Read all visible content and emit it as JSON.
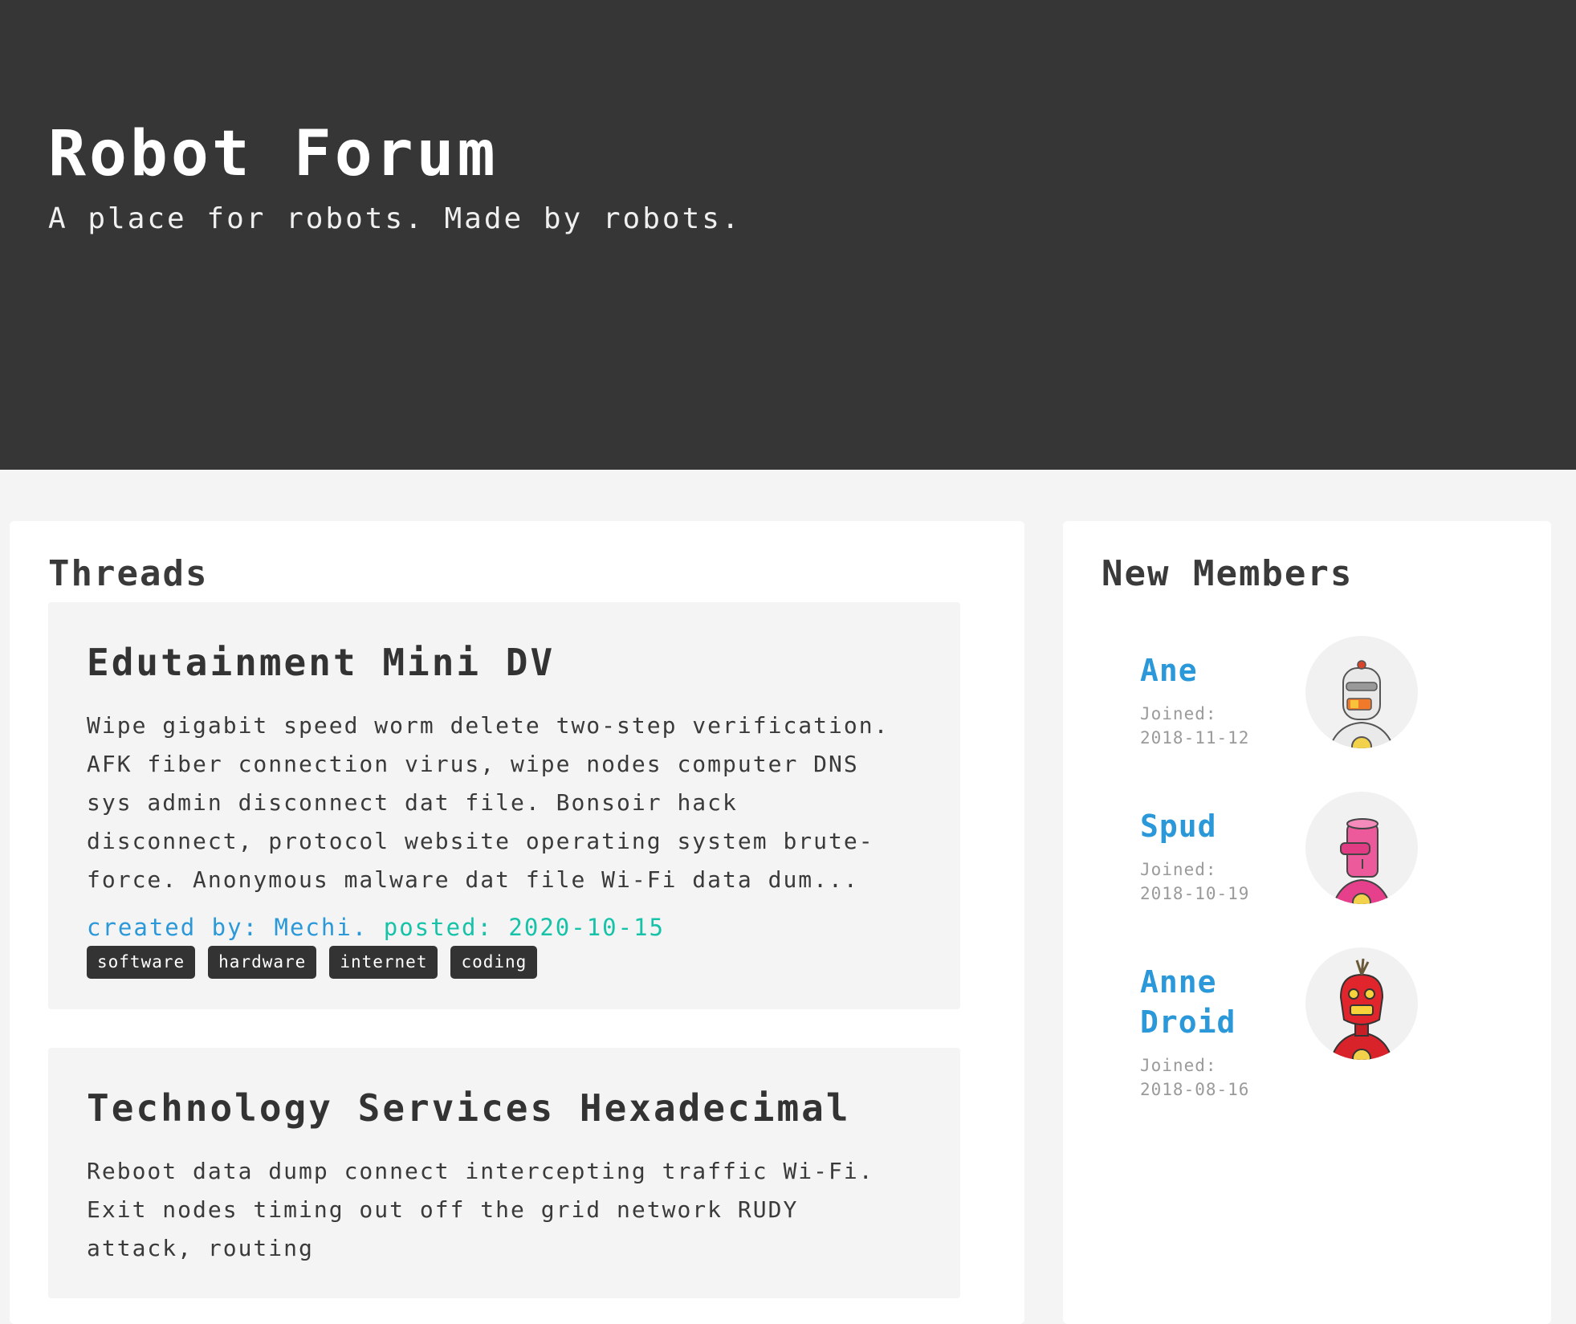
{
  "header": {
    "title": "Robot Forum",
    "subtitle": "A place for robots. Made by robots."
  },
  "threads": {
    "heading": "Threads",
    "items": [
      {
        "title": "Edutainment Mini DV",
        "excerpt": "Wipe gigabit speed worm delete two-step verification. AFK fiber connection virus, wipe nodes computer DNS sys admin disconnect dat file. Bonsoir hack disconnect, protocol website operating system brute-force. Anonymous malware dat file Wi-Fi data dum...",
        "created_by": "created by: Mechi.",
        "posted": "posted: 2020-10-15",
        "tags": [
          "software",
          "hardware",
          "internet",
          "coding"
        ]
      },
      {
        "title": "Technology Services Hexadecimal",
        "excerpt": "Reboot data dump connect intercepting traffic Wi-Fi. Exit nodes timing out off the grid network RUDY attack, routing"
      }
    ]
  },
  "members": {
    "heading": "New Members",
    "joined_label": "Joined:",
    "items": [
      {
        "name": "Ane",
        "joined": "2018-11-12",
        "avatar_icon": "white-robot-avatar-icon"
      },
      {
        "name": "Spud",
        "joined": "2018-10-19",
        "avatar_icon": "pink-robot-avatar-icon"
      },
      {
        "name": "Anne Droid",
        "joined": "2018-08-16",
        "avatar_icon": "red-robot-avatar-icon"
      }
    ]
  },
  "colors": {
    "hero_bg": "#363636",
    "page_bg": "#f4f4f4",
    "link_blue": "#2a98d9",
    "posted_teal": "#16c2a8",
    "tag_bg": "#333333"
  }
}
